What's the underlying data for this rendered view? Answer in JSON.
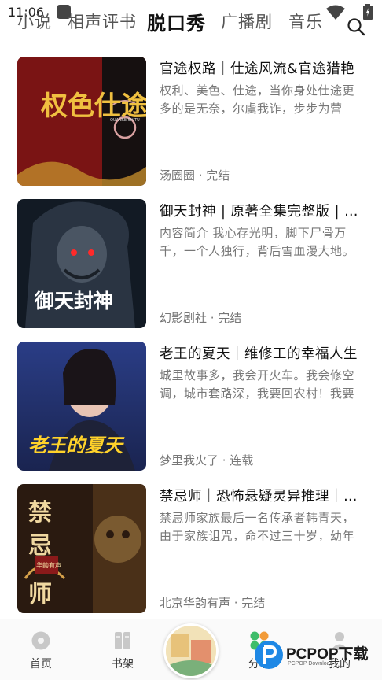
{
  "status": {
    "time": "11:06"
  },
  "tabs": [
    {
      "label": "小说"
    },
    {
      "label": "相声评书"
    },
    {
      "label": "脱口秀",
      "active": true
    },
    {
      "label": "广播剧"
    },
    {
      "label": "音乐"
    }
  ],
  "items": [
    {
      "title": "官途权路｜仕途风流&官途猎艳",
      "desc": "权利、美色、仕途，当你身处仕途更多的是无奈，尔虞我诈，步步为营",
      "meta": "汤圈圈 · 完结",
      "cover_text": "权色仕途",
      "cover_subtext": "QUANSE SHITU"
    },
    {
      "title": "御天封神 | 原著全集完整版 | 多人",
      "desc": "内容简介 我心存光明，脚下尸骨万千，一个人独行，背后雪血漫大地。",
      "meta": "幻影剧社 · 完结",
      "cover_text": "御天封神"
    },
    {
      "title": "老王的夏天｜维修工的幸福人生",
      "desc": "城里故事多，我会开火车。我会修空调，城市套路深，我要回农村！我要",
      "meta": "梦里我火了 · 连载",
      "cover_text": "老王的夏天"
    },
    {
      "title": "禁忌师｜恐怖悬疑灵异推理｜多人",
      "desc": "禁忌师家族最后一名传承者韩青天，由于家族诅咒，命不过三十岁，幼年",
      "meta": "北京华韵有声 · 完结",
      "cover_text": "禁忌师",
      "cover_subtext": "华韵有声"
    }
  ],
  "nav": {
    "home": "首页",
    "shelf": "书架",
    "share": "分享",
    "mine": "我的"
  },
  "watermark": {
    "text": "PCPOP下载",
    "sub": "PCPOP Download"
  },
  "colors": {
    "accent_green": "#3ebd6a",
    "accent_orange": "#f29b38",
    "watermark_blue": "#1e88e5"
  }
}
